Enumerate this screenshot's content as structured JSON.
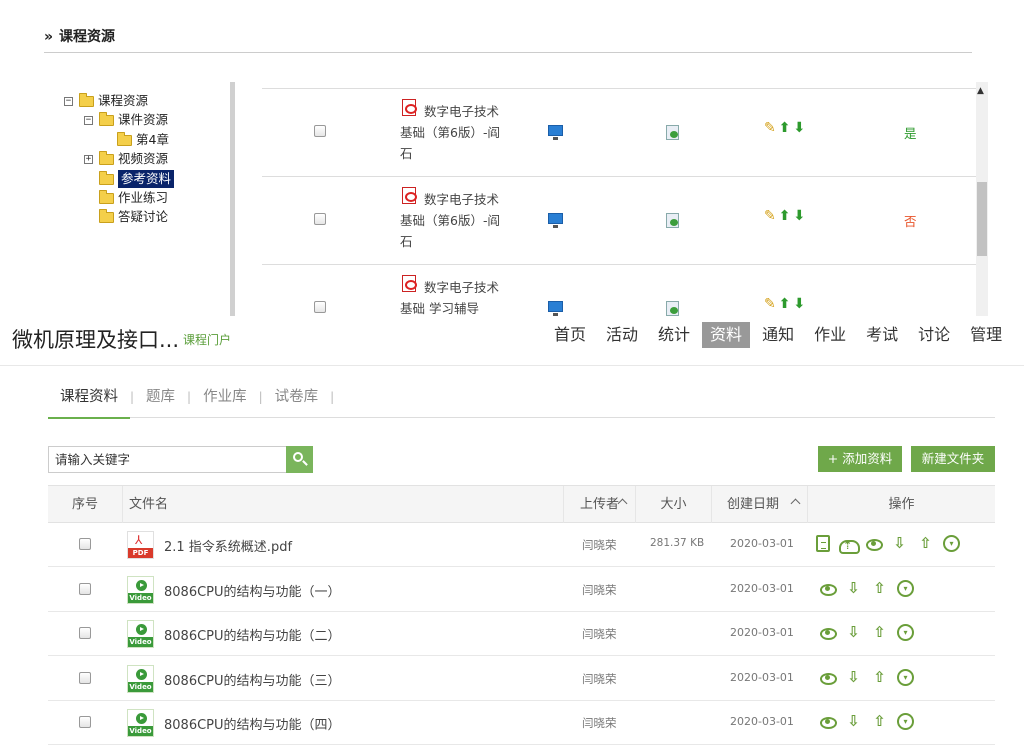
{
  "legacy": {
    "section_title": "课程资源",
    "tree": [
      {
        "label": "课程资源",
        "toggle": "−",
        "level": 0
      },
      {
        "label": "课件资源",
        "toggle": "−",
        "level": 1
      },
      {
        "label": "第4章",
        "toggle": "",
        "level": 2
      },
      {
        "label": "视频资源",
        "toggle": "+",
        "level": 1
      },
      {
        "label": "参考资料",
        "toggle": "",
        "level": 1,
        "selected": true
      },
      {
        "label": "作业练习",
        "toggle": "",
        "level": 1
      },
      {
        "label": "答疑讨论",
        "toggle": "",
        "level": 1
      }
    ],
    "rows": [
      {
        "name": "数字电子技术基础（第6版）-阎石",
        "flag": "是",
        "flag_color": "#2d9a2d"
      },
      {
        "name": "数字电子技术基础（第6版）-阎石",
        "flag": "否",
        "flag_color": "#e8552b"
      },
      {
        "name": "数字电子技术基础 学习辅导",
        "flag": "",
        "flag_color": "#e8552b"
      }
    ]
  },
  "header": {
    "course_title": "微机原理及接口...",
    "portal_link": "课程门户",
    "nav": [
      "首页",
      "活动",
      "统计",
      "资料",
      "通知",
      "作业",
      "考试",
      "讨论",
      "管理"
    ],
    "active_nav": "资料"
  },
  "subtabs": [
    "课程资料",
    "题库",
    "作业库",
    "试卷库"
  ],
  "active_subtab": "课程资料",
  "search": {
    "placeholder": "请输入关键字",
    "icon": "search-icon"
  },
  "buttons": {
    "add": "+ 添加资料",
    "new_folder": "新建文件夹"
  },
  "grid": {
    "columns": {
      "seq": "序号",
      "name": "文件名",
      "uploader": "上传者",
      "size": "大小",
      "date": "创建日期",
      "ops": "操作"
    },
    "rows": [
      {
        "type": "pdf",
        "name": "2.1 指令系统概述.pdf",
        "uploader": "闫晓荣",
        "size": "281.37 KB",
        "date": "2020-03-01",
        "ops": [
          "view-doc",
          "cloud-upload",
          "preview",
          "move-down",
          "move-up",
          "more"
        ]
      },
      {
        "type": "video",
        "name": "8086CPU的结构与功能（一）",
        "uploader": "闫晓荣",
        "size": "",
        "date": "2020-03-01",
        "ops": [
          "preview",
          "move-down",
          "move-up",
          "more"
        ]
      },
      {
        "type": "video",
        "name": "8086CPU的结构与功能（二）",
        "uploader": "闫晓荣",
        "size": "",
        "date": "2020-03-01",
        "ops": [
          "preview",
          "move-down",
          "move-up",
          "more"
        ]
      },
      {
        "type": "video",
        "name": "8086CPU的结构与功能（三）",
        "uploader": "闫晓荣",
        "size": "",
        "date": "2020-03-01",
        "ops": [
          "preview",
          "move-down",
          "move-up",
          "more"
        ]
      },
      {
        "type": "video",
        "name": "8086CPU的结构与功能（四）",
        "uploader": "闫晓荣",
        "size": "",
        "date": "2020-03-01",
        "ops": [
          "preview",
          "move-down",
          "move-up",
          "more"
        ]
      }
    ]
  },
  "colors": {
    "accent": "#6fa84a",
    "selected_tree": "#0a246a"
  }
}
